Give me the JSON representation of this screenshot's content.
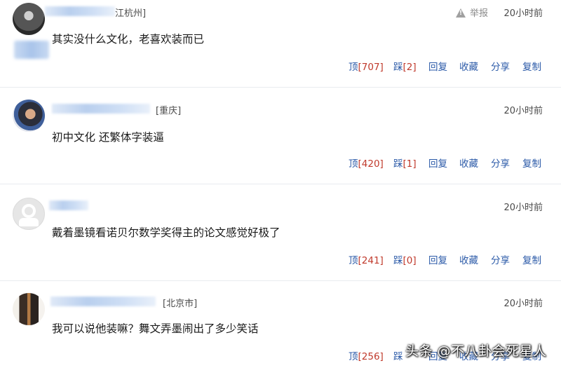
{
  "comments": [
    {
      "location": "江杭州]",
      "time": "20小时前",
      "report": "举报",
      "text": "其实没什么文化，老喜欢装而已",
      "actions": {
        "ding": "顶",
        "ding_n": "[707]",
        "cai": "踩",
        "cai_n": "[2]",
        "reply": "回复",
        "collect": "收藏",
        "share": "分享",
        "copy": "复制"
      }
    },
    {
      "location": "[重庆]",
      "time": "20小时前",
      "text": "初中文化  还繁体字装逼",
      "actions": {
        "ding": "顶",
        "ding_n": "[420]",
        "cai": "踩",
        "cai_n": "[1]",
        "reply": "回复",
        "collect": "收藏",
        "share": "分享",
        "copy": "复制"
      }
    },
    {
      "time": "20小时前",
      "text": "戴着墨镜看诺贝尔数学奖得主的论文感觉好极了",
      "actions": {
        "ding": "顶",
        "ding_n": "[241]",
        "cai": "踩",
        "cai_n": "[0]",
        "reply": "回复",
        "collect": "收藏",
        "share": "分享",
        "copy": "复制"
      }
    },
    {
      "location": "[北京市]",
      "time": "20小时前",
      "text": "我可以说他装嘛？舞文弄墨闹出了多少笑话",
      "actions": {
        "ding": "顶",
        "ding_n": "[256]",
        "cai": "踩",
        "reply": "回复",
        "collect": "收藏",
        "share": "分享",
        "copy": "复制"
      }
    }
  ],
  "watermark": "头条 @不八卦会死星人",
  "colors": {
    "link": "#2b5aa8",
    "count": "#c0392b",
    "divider": "#e8ebef"
  }
}
